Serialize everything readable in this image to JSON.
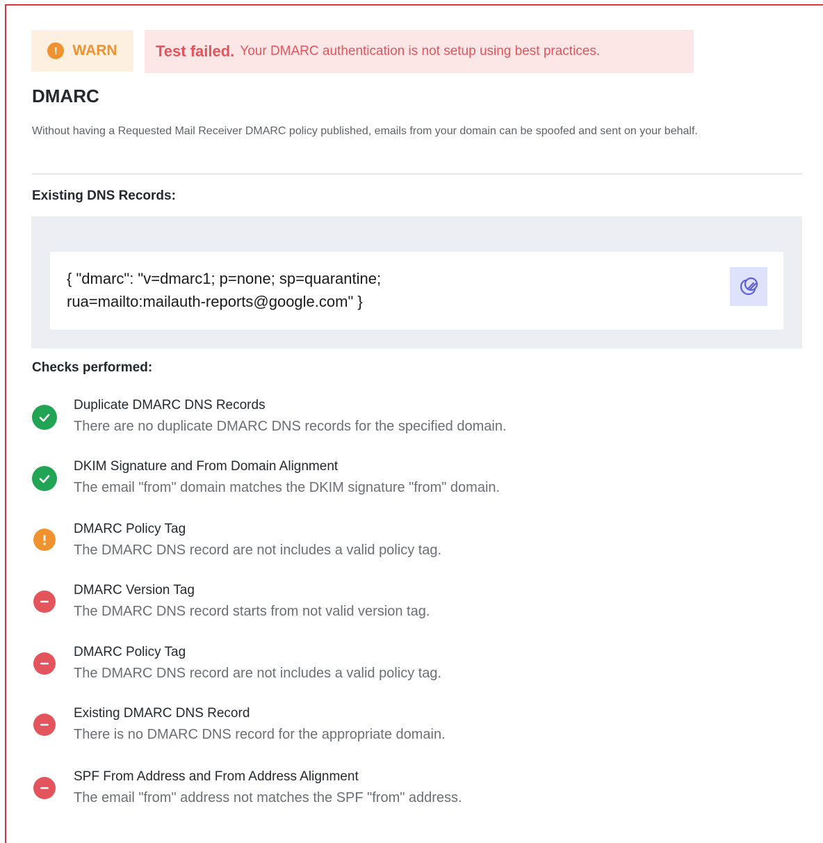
{
  "status": {
    "badge_label": "WARN",
    "badge_icon": "!",
    "fail_strong": "Test failed.",
    "fail_message": "Your DMARC authentication is not setup using best practices."
  },
  "title": "DMARC",
  "description": "Without having a Requested Mail Receiver DMARC policy published, emails from your domain can be spoofed and sent on your behalf.",
  "dns": {
    "heading": "Existing DNS Records:",
    "record_line1": "{ \"dmarc\": \"v=dmarc1; p=none; sp=quarantine;",
    "record_line2": "rua=mailto:mailauth-reports@google.com\" }",
    "copy_icon": "copy-icon"
  },
  "checks": {
    "heading": "Checks performed:",
    "items": [
      {
        "status": "pass",
        "name": "Duplicate DMARC DNS Records",
        "detail": "There are no duplicate DMARC DNS records for the specified domain."
      },
      {
        "status": "pass",
        "name": "DKIM Signature and From Domain Alignment",
        "detail": "The email \"from\" domain matches the DKIM signature \"from\" domain."
      },
      {
        "status": "warn",
        "name": "DMARC Policy Tag",
        "detail": "The DMARC DNS record are not includes a valid policy tag."
      },
      {
        "status": "fail",
        "name": "DMARC Version Tag",
        "detail": "The DMARC DNS record starts from not valid version tag."
      },
      {
        "status": "fail",
        "name": "DMARC Policy Tag",
        "detail": "The DMARC DNS record are not includes a valid policy tag."
      },
      {
        "status": "fail",
        "name": "Existing DMARC DNS Record",
        "detail": "There is no DMARC DNS record for the appropriate domain."
      },
      {
        "status": "fail",
        "name": "SPF From Address and From Address Alignment",
        "detail": "The email \"from\" address not matches the SPF \"from\" address."
      }
    ]
  },
  "colors": {
    "pass": "#22a455",
    "warn": "#f0922f",
    "fail": "#e4545c",
    "frame": "#e0323a"
  }
}
